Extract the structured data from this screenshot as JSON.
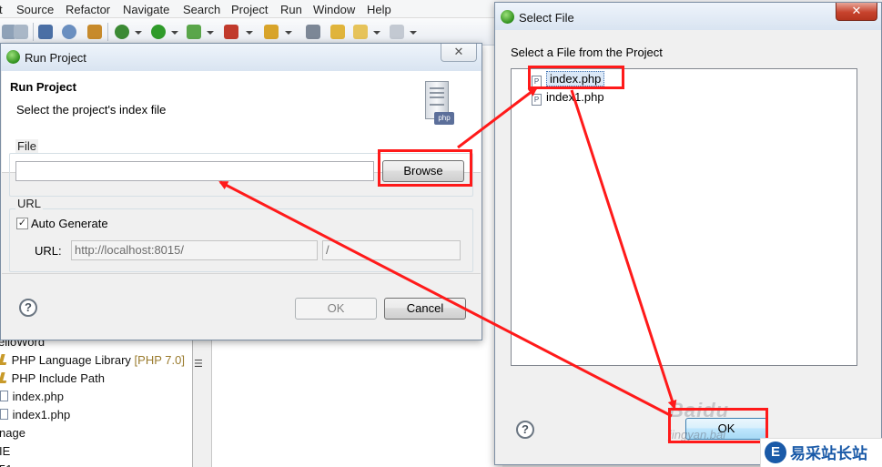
{
  "menubar": {
    "items": [
      "t",
      "Source",
      "Refactor",
      "Navigate",
      "Search",
      "Project",
      "Run",
      "Window",
      "Help"
    ]
  },
  "project_tree": {
    "items": [
      {
        "label": "elloWord",
        "version": "",
        "icon": "project-icon"
      },
      {
        "label": "PHP Language Library",
        "version": "[PHP 7.0]",
        "icon": "library-icon"
      },
      {
        "label": "PHP Include Path",
        "version": "",
        "icon": "library-icon"
      },
      {
        "label": "index.php",
        "version": "",
        "icon": "file-icon"
      },
      {
        "label": "index1.php",
        "version": "",
        "icon": "file-icon"
      },
      {
        "label": "nage",
        "version": "",
        "icon": ""
      },
      {
        "label": "IE",
        "version": "",
        "icon": ""
      },
      {
        "label": "51",
        "version": "",
        "icon": ""
      }
    ]
  },
  "run_dialog": {
    "window_title": "Run Project",
    "header_title": "Run Project",
    "header_description": "Select the project's index file",
    "file_group_label": "File",
    "file_value": "",
    "browse_label": "Browse",
    "url_group_label": "URL",
    "auto_generate_label": "Auto Generate",
    "auto_generate_checked": true,
    "url_field_label": "URL:",
    "url_value": "http://localhost:8015/",
    "url_path_value": "/",
    "help_label": "?",
    "ok_label": "OK",
    "cancel_label": "Cancel",
    "close_label": "✕",
    "server_badge": "php"
  },
  "select_dialog": {
    "window_title": "Select File",
    "prompt": "Select a File from the Project",
    "files": [
      {
        "name": "index.php",
        "selected": true
      },
      {
        "name": "index1.php",
        "selected": false
      }
    ],
    "file_badge": "P",
    "help_label": "?",
    "ok_label": "OK",
    "close_label": "✕"
  },
  "watermark": {
    "logo_letter": "E",
    "text": "易采站长站",
    "baidu_text": "Baidu",
    "baidu_sub": "jingyan.bai"
  },
  "colors": {
    "annotation_red": "#ff1a1a",
    "selection_blue": "#dbe8f7",
    "close_red": "#c7432d"
  }
}
